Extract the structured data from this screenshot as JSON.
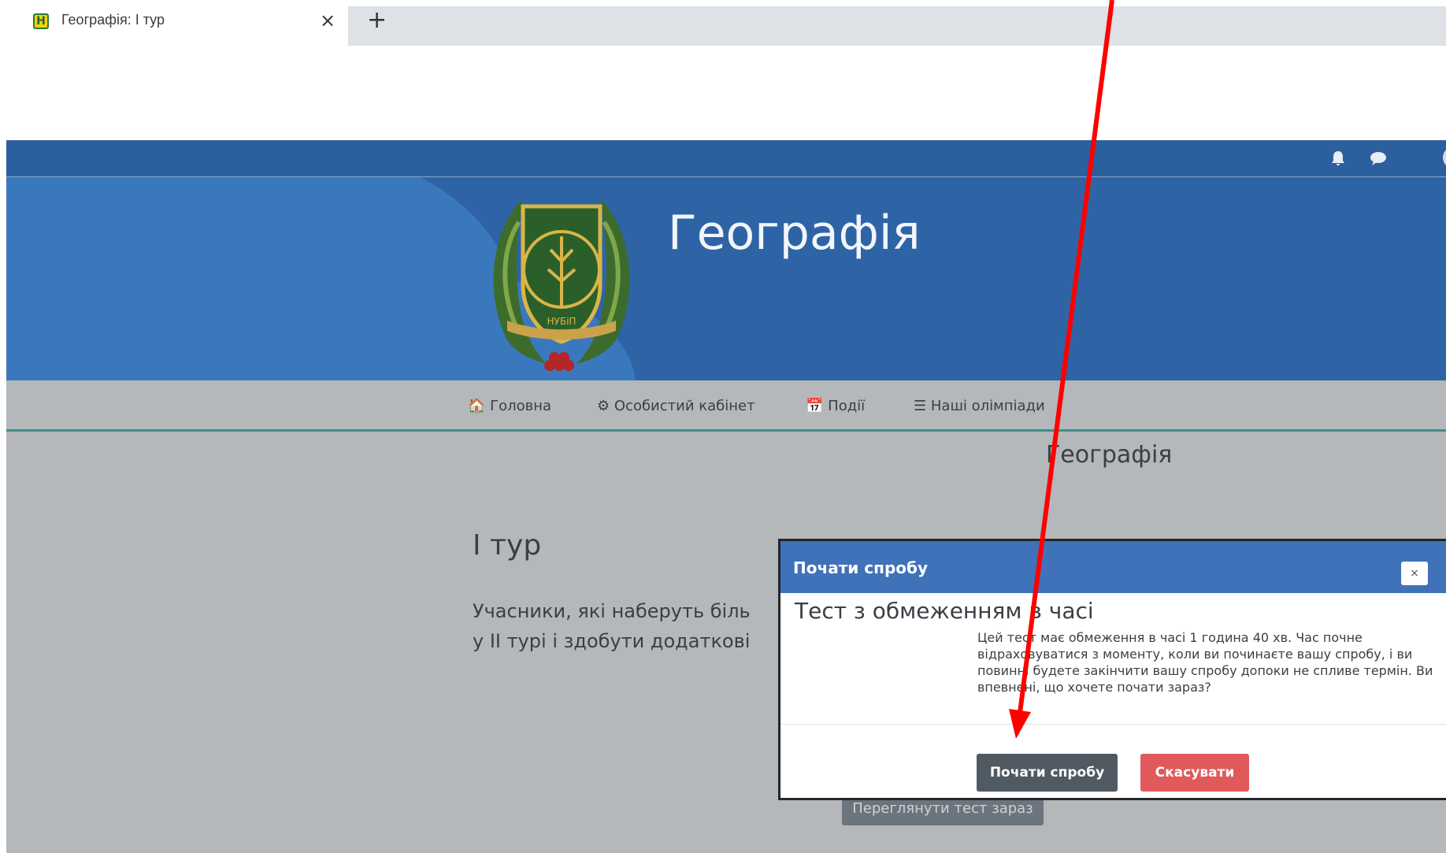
{
  "browser": {
    "tab_title": "Географія: І тур",
    "favicon_letter": "Н",
    "close_glyph": "×",
    "new_tab_glyph": "+"
  },
  "topnav": {
    "notifications_icon": "bell-icon",
    "messages_icon": "chat-icon"
  },
  "header": {
    "site_title": "Географія",
    "crest_text": "НУБіП"
  },
  "menu": {
    "items": [
      {
        "icon": "home-icon",
        "label": "Головна"
      },
      {
        "icon": "dashboard-icon",
        "label": "Особистий кабінет"
      },
      {
        "icon": "calendar-icon",
        "label": "Події"
      },
      {
        "icon": "list-icon",
        "label": "Наші олімпіади"
      }
    ]
  },
  "main": {
    "course_name": "Географія",
    "page_heading": "І тур",
    "intro_line1": "Учасники, які наберуть біль",
    "intro_line2": "у ІІ турі і здобути додаткові",
    "preview_button": "Переглянути тест зараз"
  },
  "modal": {
    "title": "Почати спробу",
    "close_glyph": "×",
    "subtitle": "Тест з обмеженням в часі",
    "body": "Цей тест має обмеження в часі 1 година 40 хв. Час почне відраховуватися з моменту, коли ви починаєте вашу спробу, і ви повинні будете закінчити вашу спробу допоки не спливе термін. Ви впевнені, що хочете почати зараз?",
    "start_button": "Почати спробу",
    "cancel_button": "Скасувати"
  },
  "colors": {
    "topnav": "#2c5f9d",
    "banner": "#2e64a6",
    "modal_header": "#3f72b8",
    "start_button": "#4f5a63",
    "cancel_button": "#e05a5c",
    "annotation_arrow": "#ff0000"
  }
}
